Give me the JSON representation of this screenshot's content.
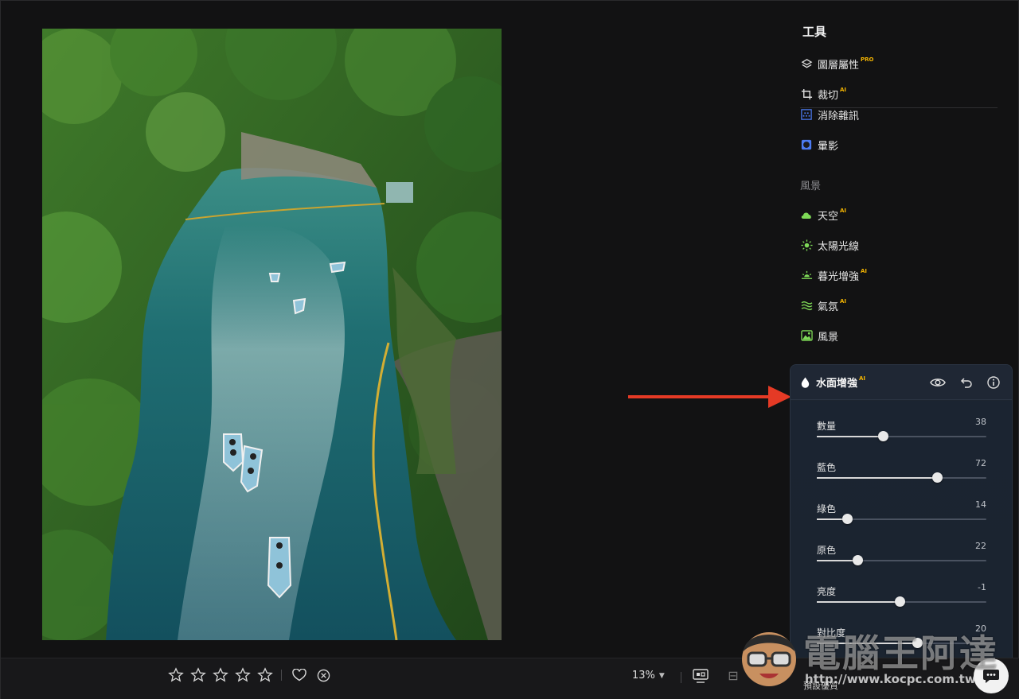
{
  "panel": {
    "title": "工具",
    "tools_top": [
      {
        "label": "圖層屬性",
        "badge": "PRO"
      },
      {
        "label": "裁切",
        "badge": "AI"
      },
      {
        "label": "消除雜訊",
        "badge": ""
      },
      {
        "label": "暈影",
        "badge": ""
      }
    ],
    "section_label": "風景",
    "tools_landscape": [
      {
        "label": "天空",
        "badge": "AI"
      },
      {
        "label": "太陽光線",
        "badge": ""
      },
      {
        "label": "暮光增強",
        "badge": "AI"
      },
      {
        "label": "氣氛",
        "badge": "AI"
      },
      {
        "label": "風景",
        "badge": ""
      }
    ]
  },
  "water_card": {
    "title": "水面增強",
    "badge": "AI",
    "sliders": [
      {
        "label": "數量",
        "value": 38,
        "position": 0.39
      },
      {
        "label": "藍色",
        "value": 72,
        "position": 0.71
      },
      {
        "label": "綠色",
        "value": 14,
        "position": 0.18
      },
      {
        "label": "原色",
        "value": 22,
        "position": 0.24
      },
      {
        "label": "亮度",
        "value": -1,
        "position": 0.49
      },
      {
        "label": "對比度",
        "value": 20,
        "position": 0.59
      }
    ]
  },
  "bottombar": {
    "zoom": "13%",
    "preset_label": "預設優質"
  },
  "watermark": {
    "text": "電腦王阿達",
    "url": "http://www.kocpc.com.tw"
  },
  "colors": {
    "accent_badge": "#f4b400",
    "arrow": "#e53a25",
    "sky_icon": "#7ed957",
    "noise_icon": "#4c7bf2"
  }
}
